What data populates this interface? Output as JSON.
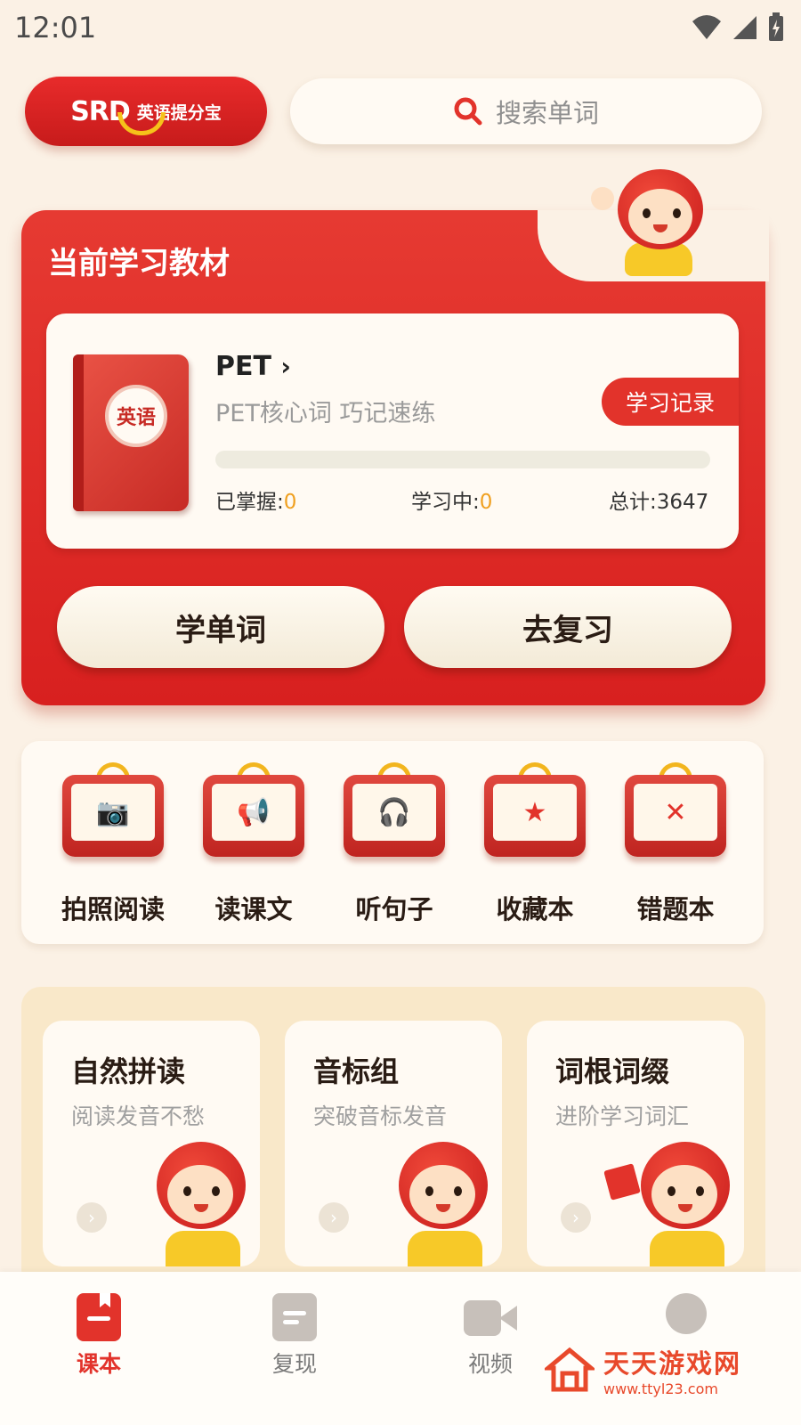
{
  "status_bar": {
    "time": "12:01"
  },
  "header": {
    "logo_brand": "SRD",
    "logo_text": "英语提分宝",
    "search_placeholder": "搜索单词"
  },
  "current_book": {
    "section_title": "当前学习教材",
    "cover_label": "英语",
    "name": "PET",
    "description": "PET核心词 巧记速练",
    "record_button": "学习记录",
    "progress_fraction": 0,
    "stats": {
      "mastered_label": "已掌握:",
      "mastered_value": "0",
      "learning_label": "学习中:",
      "learning_value": "0",
      "total_label": "总计:",
      "total_value": "3647"
    },
    "learn_button": "学单词",
    "review_button": "去复习"
  },
  "functions": [
    {
      "label": "拍照阅读",
      "icon": "camera-icon"
    },
    {
      "label": "读课文",
      "icon": "megaphone-icon"
    },
    {
      "label": "听句子",
      "icon": "headphones-icon"
    },
    {
      "label": "收藏本",
      "icon": "star-icon"
    },
    {
      "label": "错题本",
      "icon": "cross-icon"
    }
  ],
  "features": [
    {
      "title": "自然拼读",
      "subtitle": "阅读发音不愁"
    },
    {
      "title": "音标组",
      "subtitle": "突破音标发音"
    },
    {
      "title": "词根词缀",
      "subtitle": "进阶学习词汇"
    }
  ],
  "tabs": [
    {
      "label": "课本",
      "active": true
    },
    {
      "label": "复现",
      "active": false
    },
    {
      "label": "视频",
      "active": false
    }
  ],
  "watermark": {
    "title": "天天游戏网",
    "url": "www.ttyl23.com"
  },
  "colors": {
    "primary_red": "#e2332b",
    "background": "#fbf1e5",
    "cream": "#fffaf3",
    "accent_orange": "#f0a020"
  }
}
